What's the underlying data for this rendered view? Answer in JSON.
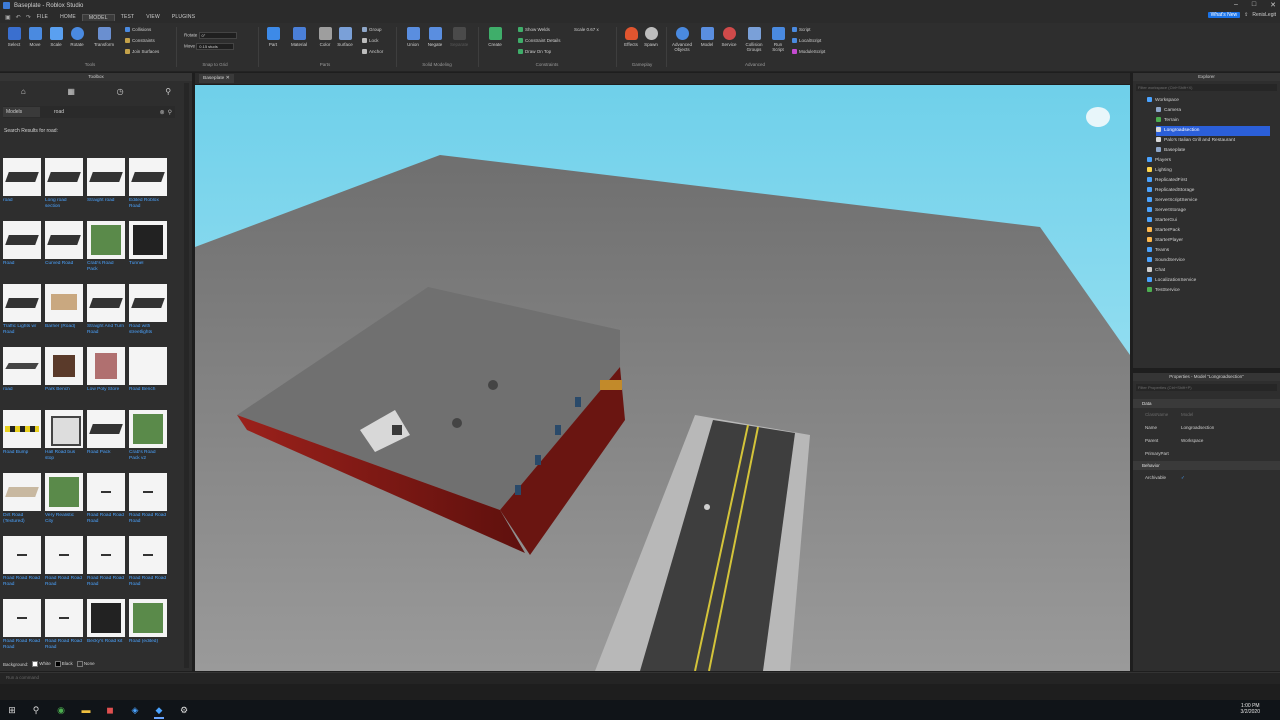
{
  "window": {
    "title": "Baseplate - Roblox Studio",
    "controls": [
      "–",
      "□",
      "✕"
    ]
  },
  "menu": {
    "tabs": [
      "FILE",
      "HOME",
      "MODEL",
      "TEST",
      "VIEW",
      "PLUGINS"
    ],
    "active": "MODEL",
    "whats_new": "What's New",
    "user": "RenisLegit"
  },
  "ribbon": {
    "tools": [
      "Select",
      "Move",
      "Scale",
      "Rotate",
      "Transform"
    ],
    "collisions": [
      "Collisions",
      "Constraints",
      "Join Surfaces"
    ],
    "tools_group": "Tools",
    "snap": {
      "rotate_label": "Rotate",
      "rotate_value": "0°",
      "move_label": "Move",
      "move_value": "0.15 studs",
      "group": "Snap to Grid"
    },
    "parts": [
      "Part",
      "Material",
      "Color",
      "Surface"
    ],
    "parts_group": "Parts",
    "group_tools": [
      "Group",
      "Lock",
      "Anchor"
    ],
    "solid": [
      "Union",
      "Negate",
      "Separate"
    ],
    "solid_group": "Solid Modeling",
    "create": "Create",
    "constraints": [
      "Show Welds",
      "Constraint Details",
      "Draw On Top"
    ],
    "scale_label": "Scale",
    "scale_value": "0.67 x",
    "constraints_group": "Constraints",
    "gameplay": [
      "Effects",
      "Spawn"
    ],
    "gameplay_group": "Gameplay",
    "advanced": [
      "Advanced Objects",
      "Model",
      "Service",
      "Collision Groups",
      "Run Script"
    ],
    "scripts": [
      "Script",
      "LocalScript",
      "ModuleScript"
    ],
    "advanced_group": "Advanced"
  },
  "toolbox": {
    "title": "Toolbox",
    "category": "Models",
    "search_value": "road",
    "results_label": "Search Results for road:",
    "items": [
      {
        "label": "road",
        "kind": "road"
      },
      {
        "label": "Long road section",
        "kind": "road"
      },
      {
        "label": "Straight road",
        "kind": "road"
      },
      {
        "label": "Edited Roblox Road",
        "kind": "road"
      },
      {
        "label": "Road",
        "kind": "road"
      },
      {
        "label": "Curved Road",
        "kind": "curve"
      },
      {
        "label": "Crab's Road Pack",
        "kind": "pack"
      },
      {
        "label": "Tunnel",
        "kind": "tunnel"
      },
      {
        "label": "Traffic Lights w/ Road",
        "kind": "road"
      },
      {
        "label": "Barrier (Road)",
        "kind": "barrier"
      },
      {
        "label": "Straight And Turn Road",
        "kind": "road"
      },
      {
        "label": "Road with streetlights",
        "kind": "road"
      },
      {
        "label": "road",
        "kind": "flat"
      },
      {
        "label": "Park Bench",
        "kind": "bench"
      },
      {
        "label": "Low Poly Store",
        "kind": "store"
      },
      {
        "label": "Road Bench",
        "kind": "blank"
      },
      {
        "label": "Road Bump",
        "kind": "bump"
      },
      {
        "label": "Hall Road bus stop",
        "kind": "busstop"
      },
      {
        "label": "Road Pack",
        "kind": "road"
      },
      {
        "label": "Crab's Road Pack v2",
        "kind": "pack"
      },
      {
        "label": "Dirt Road (Textured)",
        "kind": "dirt"
      },
      {
        "label": "Very Realistic City",
        "kind": "city"
      },
      {
        "label": "Road Road Road Road",
        "kind": "dash"
      },
      {
        "label": "Road Road Road Road",
        "kind": "dash"
      },
      {
        "label": "Road Road Road Road",
        "kind": "dash"
      },
      {
        "label": "Road Road Road Road",
        "kind": "dash"
      },
      {
        "label": "Road Road Road Road",
        "kind": "dash"
      },
      {
        "label": "Road Road Road Road",
        "kind": "dash"
      },
      {
        "label": "Road Road Road Road",
        "kind": "dash"
      },
      {
        "label": "Road Road Road Road",
        "kind": "dash"
      },
      {
        "label": "Becky's Road kit",
        "kind": "tunnel"
      },
      {
        "label": "Road (edited)",
        "kind": "pack"
      }
    ],
    "background_label": "Background:",
    "bg_options": [
      "White",
      "Black",
      "None"
    ]
  },
  "viewport": {
    "tab": "Baseplate"
  },
  "explorer": {
    "title": "Explorer",
    "filter_placeholder": "Filter workspace (Ctrl+Shift+X)",
    "items": [
      {
        "label": "Workspace",
        "indent": 0,
        "color": "#4aa3ff",
        "selected": false
      },
      {
        "label": "Camera",
        "indent": 1,
        "color": "#8fa7c9",
        "selected": false
      },
      {
        "label": "Terrain",
        "indent": 1,
        "color": "#4caf50",
        "selected": false
      },
      {
        "label": "Longroadsection",
        "indent": 1,
        "color": "#d9d9d9",
        "selected": true
      },
      {
        "label": "Palo's Italian Grill and Restaurant",
        "indent": 1,
        "color": "#d9d9d9",
        "selected": false
      },
      {
        "label": "Baseplate",
        "indent": 1,
        "color": "#8fa7c9",
        "selected": false
      },
      {
        "label": "Players",
        "indent": 0,
        "color": "#4aa3ff",
        "selected": false
      },
      {
        "label": "Lighting",
        "indent": 0,
        "color": "#ffd54a",
        "selected": false
      },
      {
        "label": "ReplicatedFirst",
        "indent": 0,
        "color": "#4aa3ff",
        "selected": false
      },
      {
        "label": "ReplicatedStorage",
        "indent": 0,
        "color": "#4aa3ff",
        "selected": false
      },
      {
        "label": "ServerScriptService",
        "indent": 0,
        "color": "#4aa3ff",
        "selected": false
      },
      {
        "label": "ServerStorage",
        "indent": 0,
        "color": "#4aa3ff",
        "selected": false
      },
      {
        "label": "StarterGui",
        "indent": 0,
        "color": "#4aa3ff",
        "selected": false
      },
      {
        "label": "StarterPack",
        "indent": 0,
        "color": "#ffb74a",
        "selected": false
      },
      {
        "label": "StarterPlayer",
        "indent": 0,
        "color": "#ffb74a",
        "selected": false
      },
      {
        "label": "Teams",
        "indent": 0,
        "color": "#4aa3ff",
        "selected": false
      },
      {
        "label": "SoundService",
        "indent": 0,
        "color": "#4aa3ff",
        "selected": false
      },
      {
        "label": "Chat",
        "indent": 0,
        "color": "#cfcfcf",
        "selected": false
      },
      {
        "label": "LocalizationService",
        "indent": 0,
        "color": "#4aa3ff",
        "selected": false
      },
      {
        "label": "TestService",
        "indent": 0,
        "color": "#4caf50",
        "selected": false
      }
    ]
  },
  "properties": {
    "title": "Properties - Model \"Longroadsection\"",
    "filter_placeholder": "Filter Properties (Ctrl+Shift+P)",
    "data_section": "Data",
    "class_name_key": "ClassName",
    "class_name_value": "Model",
    "name_key": "Name",
    "name_value": "Longroadsection",
    "parent_key": "Parent",
    "parent_value": "Workspace",
    "primary_key": "PrimaryPart",
    "behavior_section": "Behavior",
    "archivable_key": "Archivable",
    "archivable_value": "✓"
  },
  "command_bar": {
    "placeholder": "Run a command"
  },
  "taskbar": {
    "time": "1:00 PM",
    "date": "3/2/2020"
  },
  "colors": {
    "accent": "#2b5fd9",
    "sky": "#8fdcf0",
    "baseplate": "#878787",
    "brick": "#8e1d18"
  }
}
